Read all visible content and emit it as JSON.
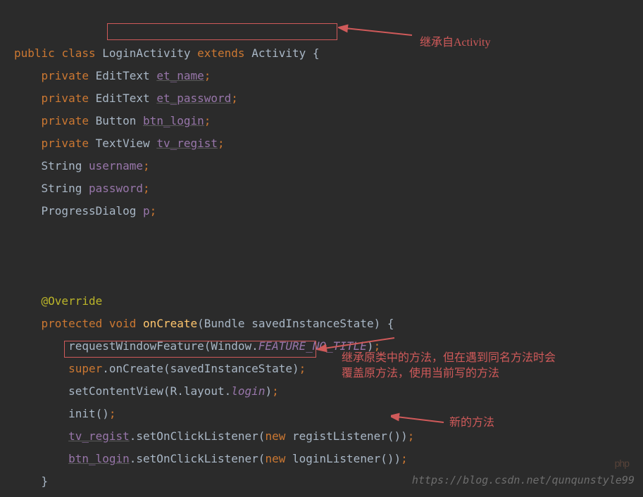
{
  "code": {
    "l1": {
      "public": "public",
      "class": "class",
      "LoginActivity": "LoginActivity",
      "extends": "extends",
      "Activity": "Activity",
      "brace": "{"
    },
    "l2": {
      "private": "private",
      "type": "EditText",
      "name": "et_name"
    },
    "l3": {
      "private": "private",
      "type": "EditText",
      "name": "et_password"
    },
    "l4": {
      "private": "private",
      "type": "Button",
      "name": "btn_login"
    },
    "l5": {
      "private": "private",
      "type": "TextView",
      "name": "tv_regist"
    },
    "l6": {
      "type": "String",
      "name": "username"
    },
    "l7": {
      "type": "String",
      "name": "password"
    },
    "l8": {
      "type": "ProgressDialog",
      "name": "p"
    },
    "l9": {
      "override": "@Override"
    },
    "l10": {
      "protected": "protected",
      "void": "void",
      "method": "onCreate",
      "param_type": "Bundle",
      "param_name": "savedInstanceState",
      "brace": "{"
    },
    "l11": {
      "call": "requestWindowFeature",
      "arg_cls": "Window",
      "dot": ".",
      "arg_mem": "FEATURE_NO_TITLE"
    },
    "l12": {
      "super": "super",
      "dot": ".",
      "call": "onCreate",
      "arg": "savedInstanceState"
    },
    "l13": {
      "call": "setContentView",
      "arg_cls": "R",
      "dot1": ".",
      "arg_mem1": "layout",
      "dot2": ".",
      "arg_mem2": "login"
    },
    "l14": {
      "call": "init"
    },
    "l15": {
      "recv": "tv_regist",
      "dot": ".",
      "call": "setOnClickListener",
      "new": "new",
      "ctor": "registListener"
    },
    "l16": {
      "recv": "btn_login",
      "dot": ".",
      "call": "setOnClickListener",
      "new": "new",
      "ctor": "loginListener"
    },
    "l17": {
      "brace": "}"
    }
  },
  "annotations": {
    "a1": "继承自Activity",
    "a2_line1": "继承原类中的方法，但在遇到同名方法时会",
    "a2_line2": "覆盖原方法，使用当前写的方法",
    "a3": "新的方法"
  },
  "watermark": "https://blog.csdn.net/qunqunstyle99",
  "phplogo": "php"
}
